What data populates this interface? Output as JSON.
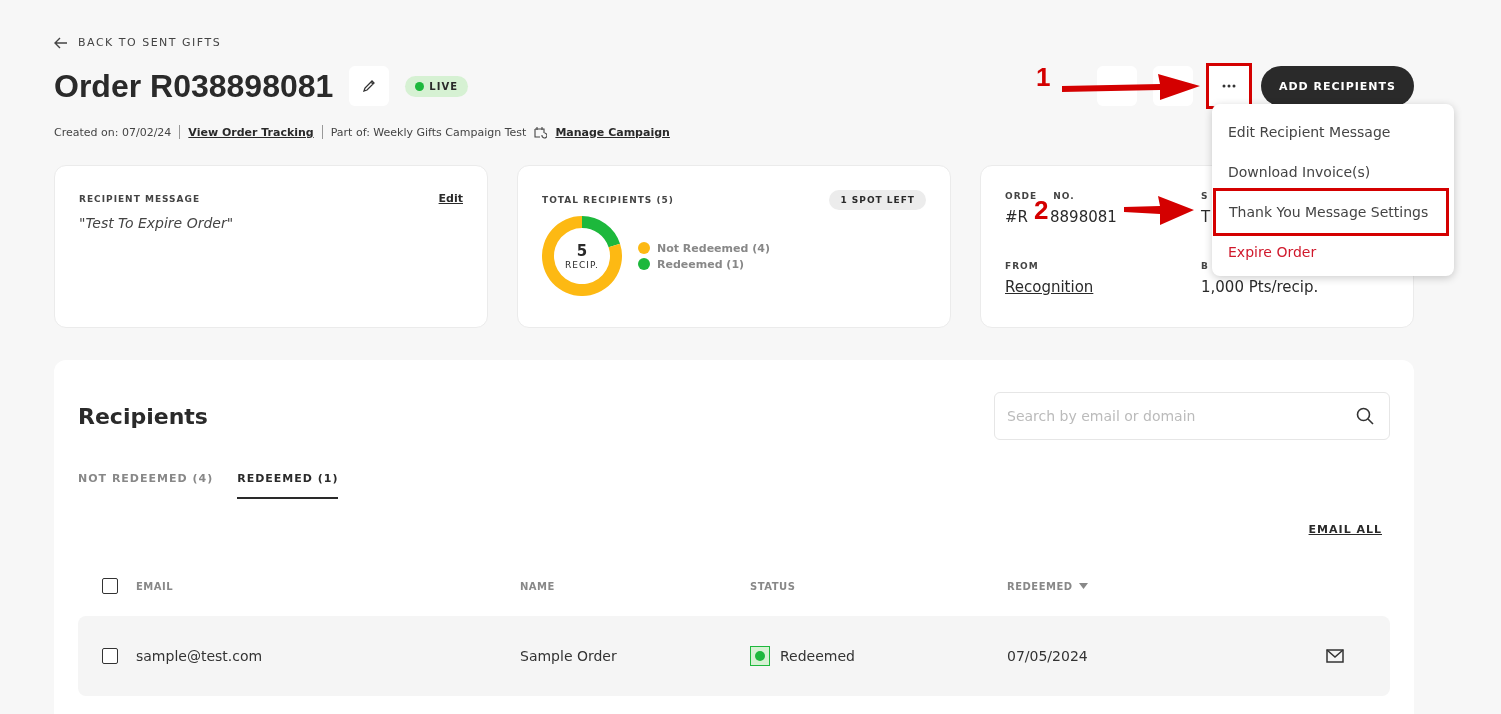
{
  "back_link": "BACK TO SENT GIFTS",
  "title": "Order R038898081",
  "status_badge": {
    "label": "LIVE",
    "color": "#1db83c"
  },
  "meta": {
    "created": "Created on: 07/02/24",
    "tracking_link": "View Order Tracking",
    "part_of": "Part of: Weekly Gifts Campaign Test",
    "campaign_link": "Manage Campaign"
  },
  "more_button": {
    "highlighted": true
  },
  "primary_button": "ADD RECIPIENTS",
  "more_menu": {
    "expanded": true,
    "items": [
      {
        "label": "Edit Recipient Message",
        "kind": "normal",
        "highlighted": false
      },
      {
        "label": "Download Invoice(s)",
        "kind": "normal",
        "highlighted": false
      },
      {
        "label": "Thank You Message Settings",
        "kind": "normal",
        "highlighted": true
      },
      {
        "label": "Expire Order",
        "kind": "danger",
        "highlighted": false
      }
    ]
  },
  "message_card": {
    "title": "RECIPIENT MESSAGE",
    "edit": "Edit",
    "message": "\"Test To Expire Order\""
  },
  "recipients_card": {
    "title": "TOTAL RECIPIENTS (5)",
    "badge": "1 SPOT LEFT",
    "total": "5",
    "total_label": "RECIP.",
    "chart_data": {
      "type": "donut",
      "categories": [
        "Not Redeemed (4)",
        "Redeemed (1)"
      ],
      "values": [
        4,
        1
      ],
      "colors": [
        "#fdb913",
        "#1db83c"
      ]
    }
  },
  "order_card": {
    "fields": [
      {
        "label": "ORDE",
        "label_rest": "NO.",
        "value": "#R",
        "value_rest": "8898081",
        "kind": "plain"
      },
      {
        "label": "S",
        "value": "T",
        "kind": "plain"
      },
      {
        "label": "FROM",
        "value": "Recognition",
        "kind": "link"
      },
      {
        "label": "B",
        "value": "1,000 Pts/recip.",
        "kind": "plain"
      }
    ]
  },
  "recipients": {
    "title": "Recipients",
    "search": {
      "placeholder": "Search by email or domain"
    },
    "tabs": [
      {
        "label": "NOT REDEEMED (4)",
        "selected": false
      },
      {
        "label": "REDEEMED (1)",
        "selected": true
      }
    ],
    "email_all": "EMAIL ALL",
    "select_all": {
      "checked": false
    },
    "columns": [
      "EMAIL",
      "NAME",
      "STATUS",
      "REDEEMED"
    ],
    "rows": [
      {
        "email": "sample@test.com",
        "name": "Sample Order",
        "status": "Redeemed",
        "redeemed": "07/05/2024",
        "checked": false
      }
    ]
  },
  "annotations": [
    {
      "number": "1"
    },
    {
      "number": "2"
    }
  ]
}
